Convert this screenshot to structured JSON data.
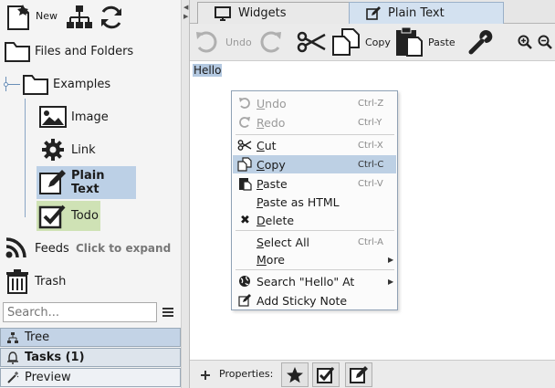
{
  "left_toolbar": {
    "new_label": "New"
  },
  "tree": {
    "items": [
      {
        "label": "Files and Folders"
      },
      {
        "label": "Examples"
      },
      {
        "label": "Image"
      },
      {
        "label": "Link"
      },
      {
        "label": "Plain Text"
      },
      {
        "label": "Todo"
      },
      {
        "label": "Feeds",
        "hint": "Click to expand"
      },
      {
        "label": "Trash"
      }
    ]
  },
  "search": {
    "placeholder": "Search..."
  },
  "panel_tabs": {
    "tree": "Tree",
    "tasks": "Tasks (1)",
    "preview": "Preview"
  },
  "tabs": [
    {
      "label": "Widgets"
    },
    {
      "label": "Plain Text"
    }
  ],
  "toolbar": {
    "undo": "Undo",
    "copy": "Copy",
    "paste": "Paste"
  },
  "editor": {
    "text": "Hello"
  },
  "context_menu": {
    "items": [
      {
        "label": "Undo",
        "shortcut": "Ctrl-Z"
      },
      {
        "label": "Redo",
        "shortcut": "Ctrl-Y"
      },
      {
        "label": "Cut",
        "shortcut": "Ctrl-X"
      },
      {
        "label": "Copy",
        "shortcut": "Ctrl-C"
      },
      {
        "label": "Paste",
        "shortcut": "Ctrl-V"
      },
      {
        "label": "Paste as HTML"
      },
      {
        "label": "Delete"
      },
      {
        "label": "Select All",
        "shortcut": "Ctrl-A"
      },
      {
        "label": "More"
      },
      {
        "label": "Search \"Hello\" At"
      },
      {
        "label": "Add Sticky Note"
      }
    ]
  },
  "properties": {
    "label": "Properties:"
  },
  "colors": {
    "selection": "#bcd0e6",
    "todo_selection": "#cfe2b5",
    "menu_highlight": "#bdd0e4"
  }
}
